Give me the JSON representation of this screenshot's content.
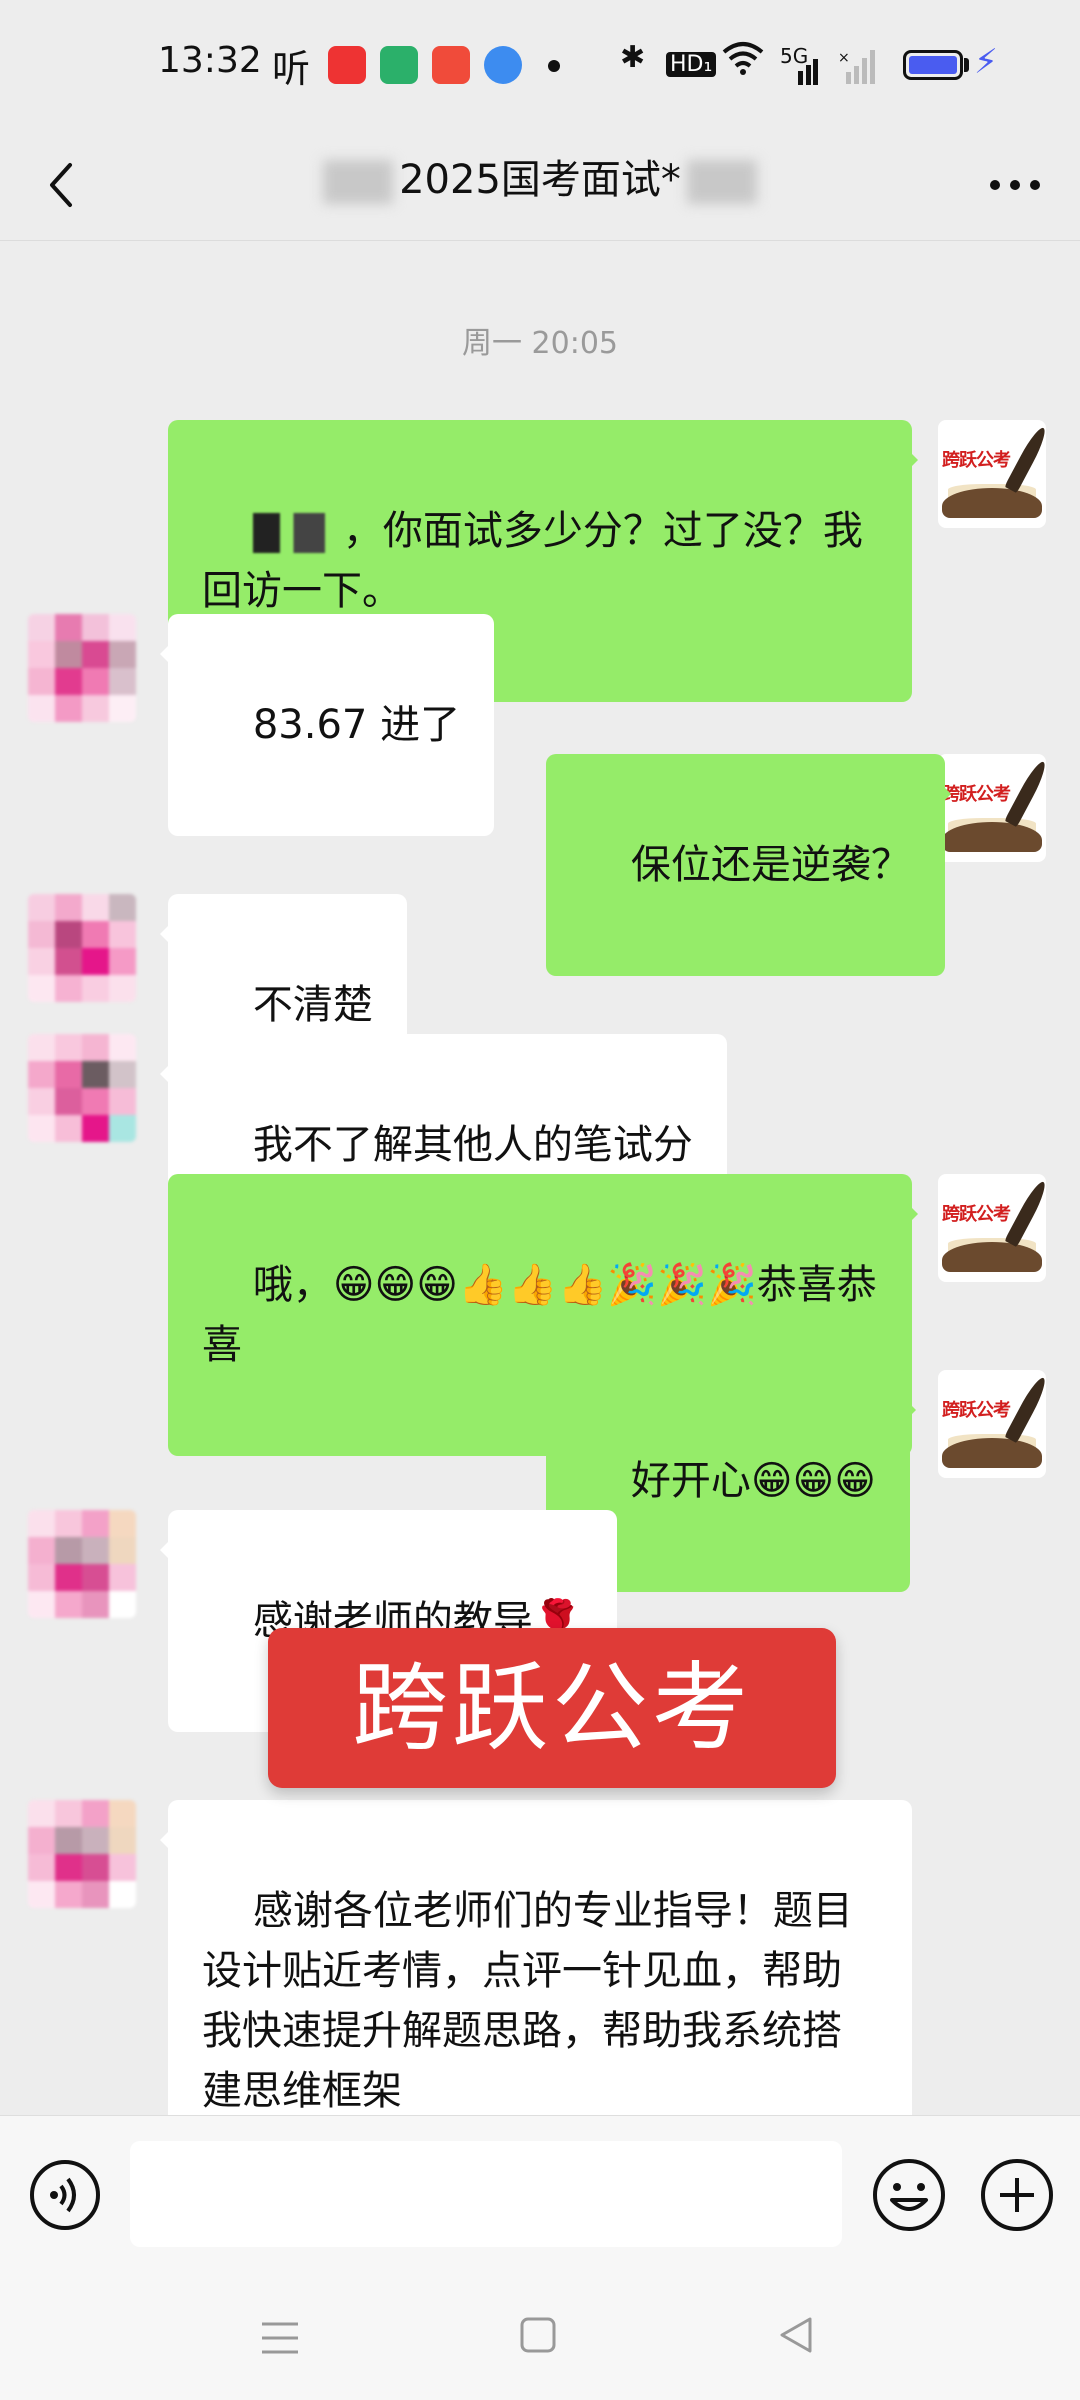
{
  "status_bar": {
    "time": "13:32",
    "listen_label": "听",
    "network_label": "5G",
    "hd_label": "HD₁"
  },
  "header": {
    "title": "2025国考面试*"
  },
  "chat": {
    "timestamp": "周一 20:05",
    "messages": [
      {
        "side": "me",
        "text": "，你面试多少分？过了没？我回访一下。"
      },
      {
        "side": "other",
        "text": "83.67 进了"
      },
      {
        "side": "me",
        "text": "保位还是逆袭？"
      },
      {
        "side": "other",
        "text": "不清楚"
      },
      {
        "side": "other",
        "text": "我不了解其他人的笔试分"
      },
      {
        "side": "me",
        "text": "哦，😁😁😁👍👍👍🎉🎉🎉恭喜恭喜"
      },
      {
        "side": "me",
        "text": "好开心😁😁😁"
      },
      {
        "side": "other",
        "text": "感谢老师的教导🌹"
      },
      {
        "side": "other",
        "text": "感谢各位老师们的专业指导！题目设计贴近考情，点评一针见血，帮助我快速提升解题思路，帮助我系统搭建思维框架"
      }
    ],
    "my_avatar_label": "跨跃公考",
    "watermark_banner": "跨跃公考"
  },
  "input_bar": {
    "value": "",
    "placeholder": ""
  },
  "colors": {
    "my_bubble": "#95ec69",
    "other_bubble": "#ffffff",
    "background": "#ededed",
    "banner": "#df3b37"
  },
  "icons": [
    "back-icon",
    "more-icon",
    "voice-icon",
    "emoji-icon",
    "plus-icon",
    "nav-menu-icon",
    "nav-home-icon",
    "nav-back-icon"
  ]
}
